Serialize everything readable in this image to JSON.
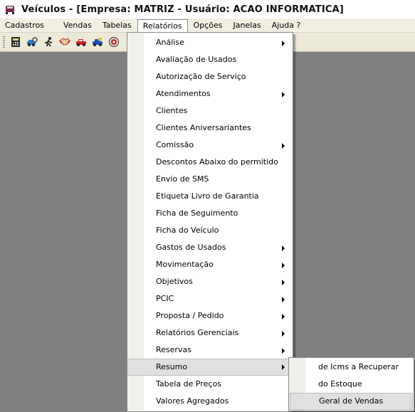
{
  "window": {
    "title": "Veículos - [Empresa: MATRIZ - Usuário: ACAO INFORMATICA]"
  },
  "menubar": {
    "items": [
      {
        "label": "Cadastros"
      },
      {
        "label": "Vendas"
      },
      {
        "label": "Tabelas"
      },
      {
        "label": "Relatórios"
      },
      {
        "label": "Opções"
      },
      {
        "label": "Janelas"
      },
      {
        "label": "Ajuda ?"
      }
    ]
  },
  "toolbar": {
    "buttons": [
      "calculator-icon",
      "car-search-icon",
      "running-man-icon",
      "handshake-icon",
      "red-car-icon",
      "blue-car-icon",
      "disc-icon"
    ]
  },
  "relatorios_menu": {
    "items": [
      {
        "label": "Análise",
        "submenu": true
      },
      {
        "label": "Avaliação de Usados",
        "submenu": false
      },
      {
        "label": "Autorização de Serviço",
        "submenu": false
      },
      {
        "label": "Atendimentos",
        "submenu": true
      },
      {
        "label": "Clientes",
        "submenu": false
      },
      {
        "label": "Clientes Aniversariantes",
        "submenu": false
      },
      {
        "label": "Comissão",
        "submenu": true
      },
      {
        "label": "Descontos Abaixo do permitido",
        "submenu": false
      },
      {
        "label": "Envio de SMS",
        "submenu": false
      },
      {
        "label": "Etiqueta Livro de Garantia",
        "submenu": false
      },
      {
        "label": "Ficha de Seguimento",
        "submenu": false
      },
      {
        "label": "Ficha do Veículo",
        "submenu": false
      },
      {
        "label": "Gastos de Usados",
        "submenu": true
      },
      {
        "label": "Movimentação",
        "submenu": true
      },
      {
        "label": "Objetivos",
        "submenu": true
      },
      {
        "label": "PCIC",
        "submenu": true
      },
      {
        "label": "Proposta / Pedido",
        "submenu": true
      },
      {
        "label": "Relatórios Gerenciais",
        "submenu": true
      },
      {
        "label": "Reservas",
        "submenu": true
      },
      {
        "label": "Resumo",
        "submenu": true,
        "highlighted": true
      },
      {
        "label": "Tabela de Preços",
        "submenu": false
      },
      {
        "label": "Valores Agregados",
        "submenu": false
      }
    ]
  },
  "resumo_submenu": {
    "items": [
      {
        "label": "de Icms a Recuperar"
      },
      {
        "label": "do Estoque"
      },
      {
        "label": "Geral de Vendas",
        "highlighted": true
      }
    ]
  }
}
